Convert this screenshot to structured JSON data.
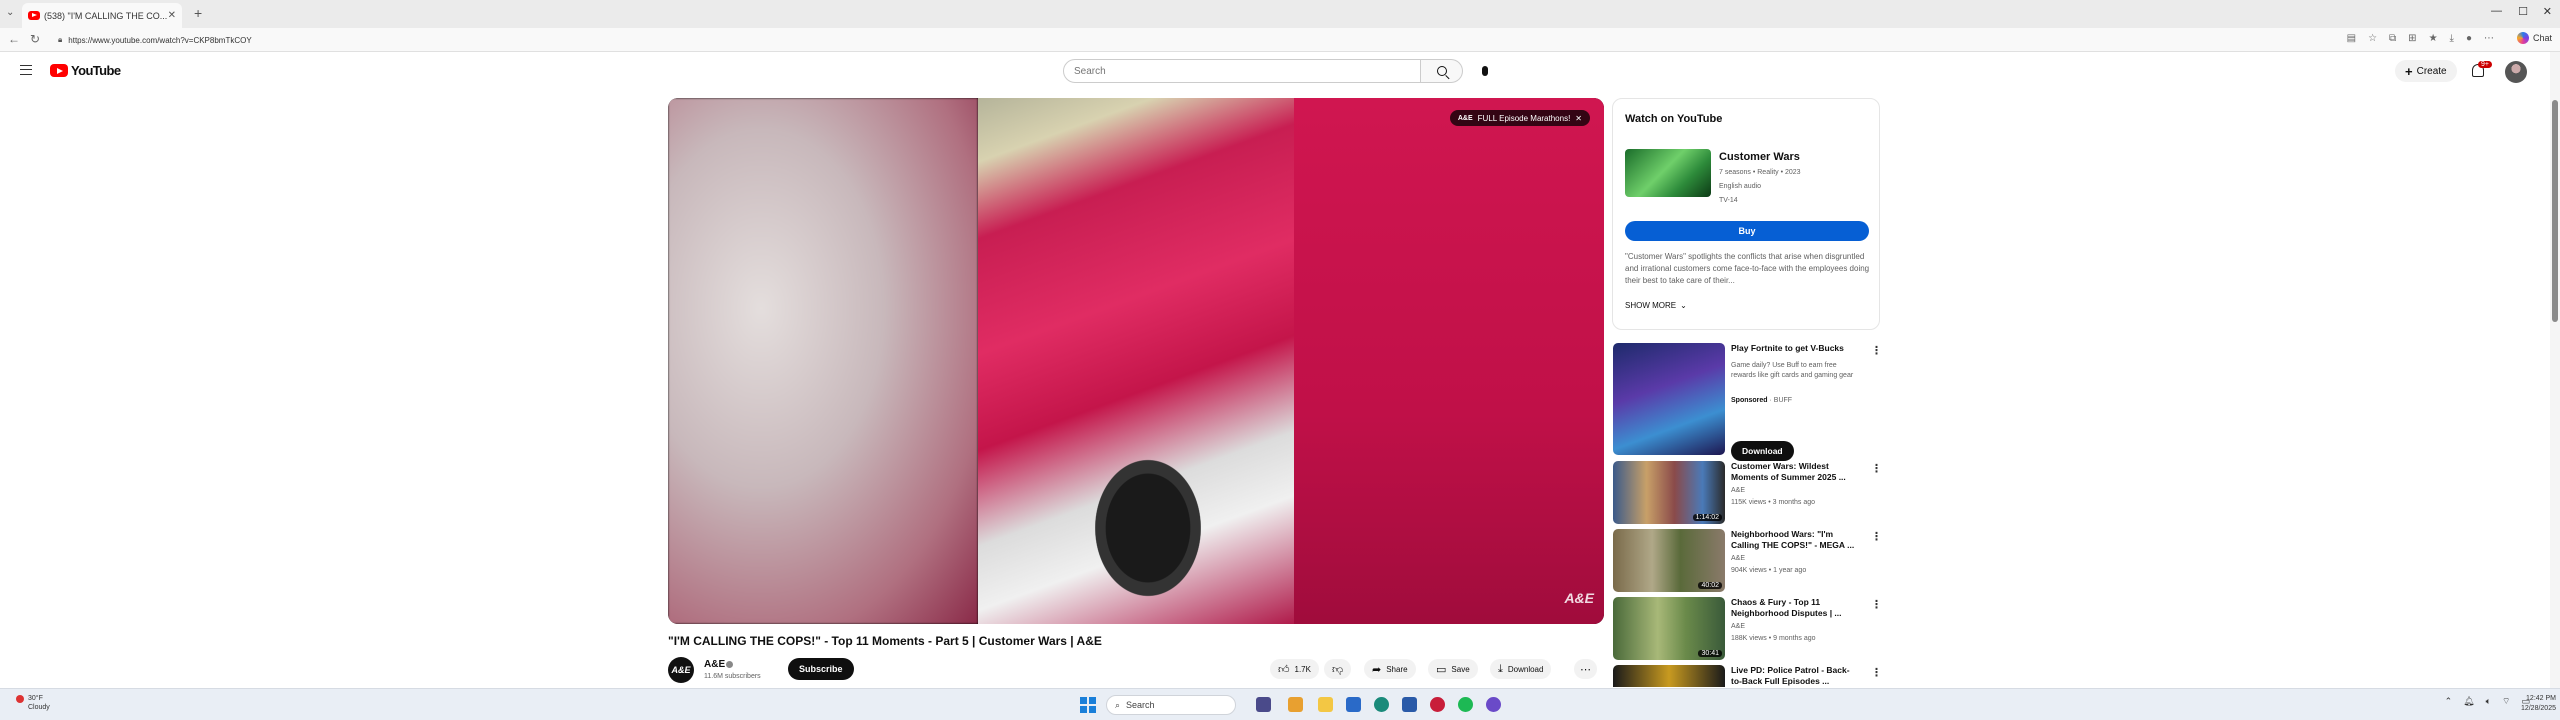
{
  "browser": {
    "tab_title": "(538) \"I'M CALLING THE CO...",
    "url": "https://www.youtube.com/watch?v=CKP8bmTkCOY",
    "copilot_label": "Chat"
  },
  "header": {
    "logo_text": "YouTube",
    "search_placeholder": "Search",
    "create_label": "Create",
    "notification_count": "9+"
  },
  "player": {
    "episode_pill": "FULL Episode Marathons!",
    "watermark": "A&E"
  },
  "video": {
    "title": "\"I'M CALLING THE COPS!\" - Top 11 Moments - Part 5 | Customer Wars | A&E",
    "channel": "A&E",
    "channel_avatar": "A&E",
    "subscribers": "11.6M subscribers",
    "subscribe_label": "Subscribe",
    "likes": "1.7K",
    "share_label": "Share",
    "save_label": "Save",
    "download_label": "Download"
  },
  "watch_card": {
    "heading": "Watch on YouTube",
    "show_title": "Customer Wars",
    "meta_line1": "7 seasons • Reality • 2023",
    "meta_line2": "English audio",
    "meta_line3": "TV-14",
    "buy_label": "Buy",
    "description": "\"Customer Wars\" spotlights the conflicts that arise when disgruntled and irrational customers come face-to-face with the employees doing their best to take care of their...",
    "show_more": "SHOW MORE"
  },
  "recommendations": [
    {
      "title": "Play Fortnite to get V-Bucks",
      "desc": "Game daily? Use Buff to earn free rewards like gift cards and gaming gear",
      "sponsored": "Sponsored",
      "advertiser": "BUFF",
      "cta": "Download"
    },
    {
      "title": "Customer Wars: Wildest Moments of Summer 2025 ...",
      "channel": "A&E",
      "meta": "115K views • 3 months ago",
      "duration": "1:14:02"
    },
    {
      "title": "Neighborhood Wars: \"I'm Calling THE COPS!\" - MEGA ...",
      "channel": "A&E",
      "meta": "904K views • 1 year ago",
      "duration": "40:02"
    },
    {
      "title": "Chaos & Fury - Top 11 Neighborhood Disputes | ...",
      "channel": "A&E",
      "meta": "188K views • 9 months ago",
      "duration": "30:41"
    },
    {
      "title": "Live PD: Police Patrol - Back-to-Back Full Episodes ...",
      "channel": "",
      "meta": ""
    }
  ],
  "taskbar": {
    "weather_temp": "30°F",
    "weather_desc": "Cloudy",
    "search_label": "Search",
    "time": "12:42 PM",
    "date": "12/28/2025"
  }
}
